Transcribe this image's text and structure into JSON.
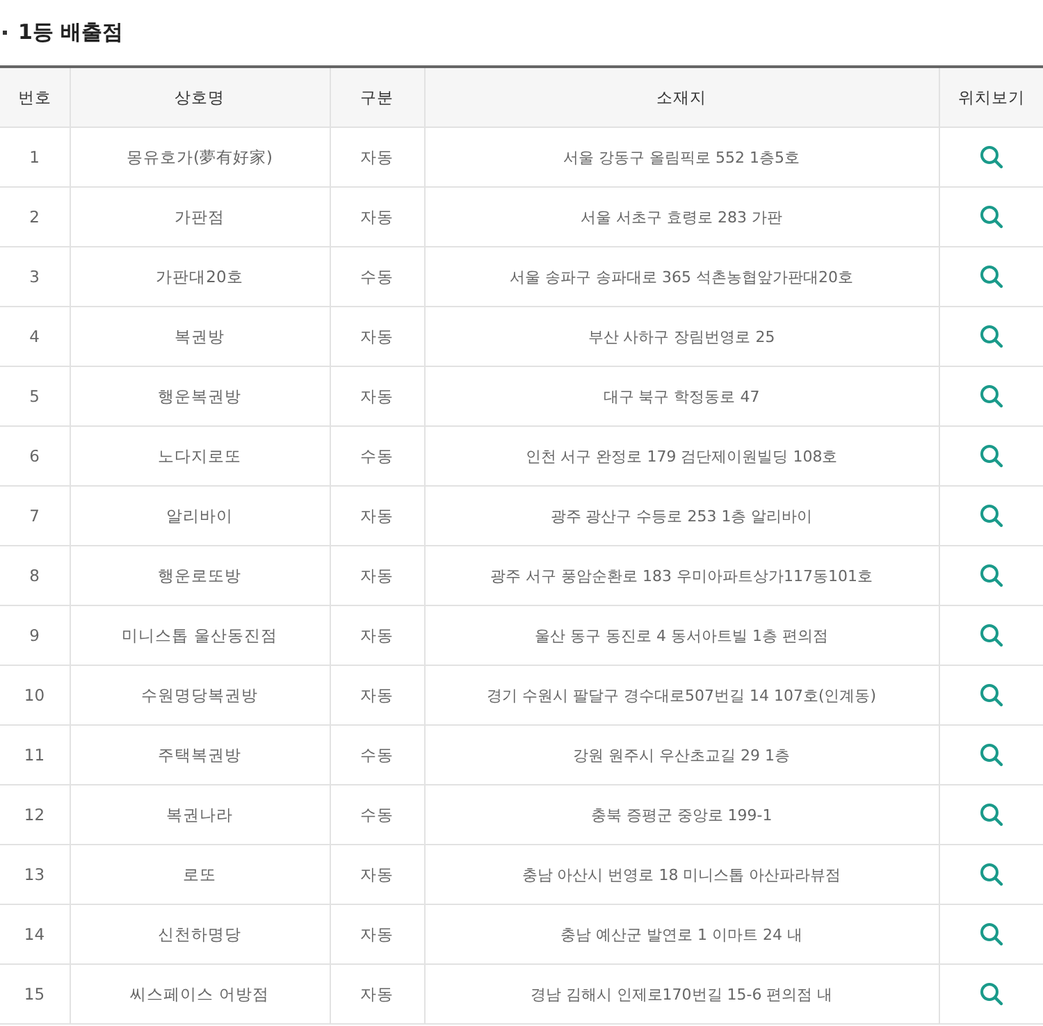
{
  "title": "1등 배출점",
  "table": {
    "columns": [
      "번호",
      "상호명",
      "구분",
      "소재지",
      "위치보기"
    ],
    "rows": [
      {
        "no": "1",
        "name": "몽유호가(夢有好家)",
        "type": "자동",
        "address": "서울 강동구 올림픽로 552 1층5호"
      },
      {
        "no": "2",
        "name": "가판점",
        "type": "자동",
        "address": "서울 서초구 효령로 283 가판"
      },
      {
        "no": "3",
        "name": "가판대20호",
        "type": "수동",
        "address": "서울 송파구 송파대로 365 석촌농협앞가판대20호"
      },
      {
        "no": "4",
        "name": "복권방",
        "type": "자동",
        "address": "부산 사하구 장림번영로 25"
      },
      {
        "no": "5",
        "name": "행운복권방",
        "type": "자동",
        "address": "대구 북구 학정동로 47"
      },
      {
        "no": "6",
        "name": "노다지로또",
        "type": "수동",
        "address": "인천 서구 완정로 179 검단제이원빌딩 108호"
      },
      {
        "no": "7",
        "name": "알리바이",
        "type": "자동",
        "address": "광주 광산구 수등로 253 1층 알리바이"
      },
      {
        "no": "8",
        "name": "행운로또방",
        "type": "자동",
        "address": "광주 서구 풍암순환로 183 우미아파트상가117동101호"
      },
      {
        "no": "9",
        "name": "미니스톱 울산동진점",
        "type": "자동",
        "address": "울산 동구 동진로 4 동서아트빌 1층 편의점"
      },
      {
        "no": "10",
        "name": "수원명당복권방",
        "type": "자동",
        "address": "경기 수원시 팔달구 경수대로507번길 14 107호(인계동)"
      },
      {
        "no": "11",
        "name": "주택복권방",
        "type": "수동",
        "address": "강원 원주시 우산초교길 29 1층"
      },
      {
        "no": "12",
        "name": "복권나라",
        "type": "수동",
        "address": "충북 증평군 중앙로 199-1"
      },
      {
        "no": "13",
        "name": "로또",
        "type": "자동",
        "address": "충남 아산시 번영로 18 미니스톱 아산파라뷰점"
      },
      {
        "no": "14",
        "name": "신천하명당",
        "type": "자동",
        "address": "충남 예산군 발연로 1 이마트 24 내"
      },
      {
        "no": "15",
        "name": "씨스페이스 어방점",
        "type": "자동",
        "address": "경남 김해시 인제로170번길 15-6 편의점 내"
      }
    ]
  }
}
